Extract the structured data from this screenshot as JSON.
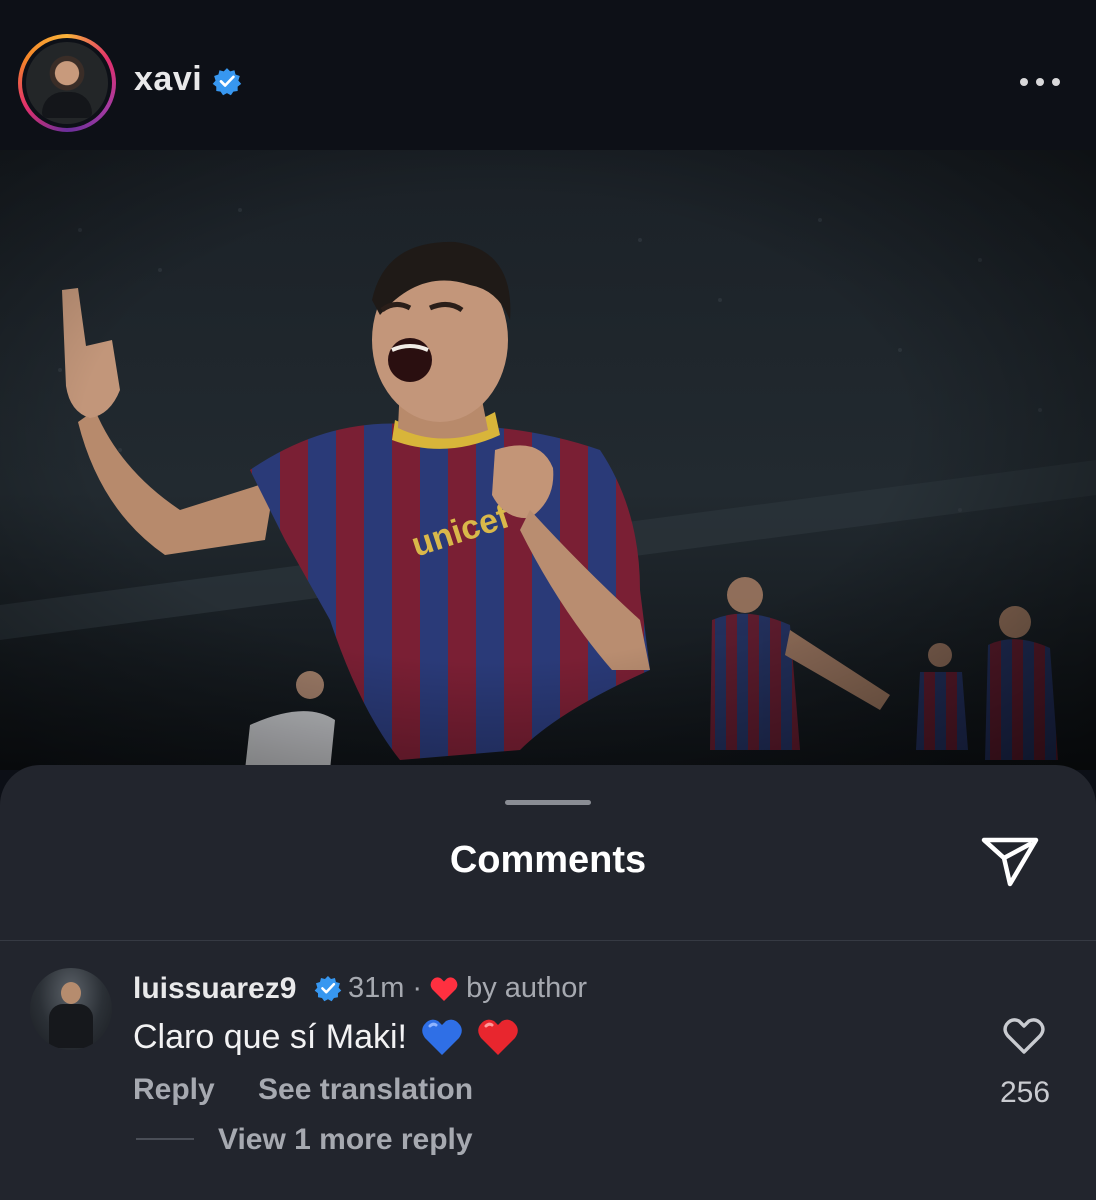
{
  "post": {
    "username": "xavi",
    "verified": true,
    "avatar_icon": "profile-avatar",
    "more_icon": "ellipsis-icon"
  },
  "sheet": {
    "title": "Comments",
    "share_icon": "paper-plane-icon"
  },
  "comment": {
    "username": "luissuarez9",
    "verified": true,
    "time": "31m",
    "separator": "·",
    "liked_by_author_label": "by author",
    "text": "Claro que sí Maki!",
    "emojis": [
      "blue-heart",
      "red-heart"
    ],
    "reply_label": "Reply",
    "translate_label": "See translation",
    "like_count": "256",
    "view_replies_label": "View 1 more reply"
  },
  "colors": {
    "background": "#0c0f16",
    "sheet": "#22252d",
    "verified_blue": "#3797f0",
    "heart_red": "#ff3040",
    "secondary_text": "#a6a9b0"
  }
}
